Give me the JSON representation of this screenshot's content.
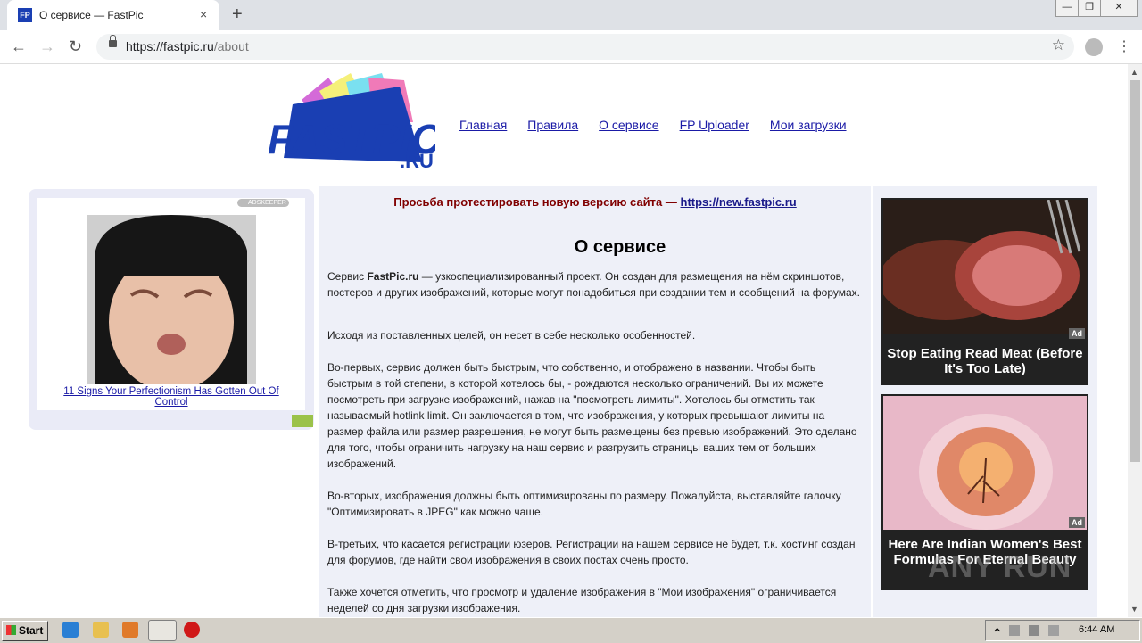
{
  "browser": {
    "tab_title": "О сервисе — FastPic",
    "favicon_text": "FP",
    "tab_close": "×",
    "new_tab": "+",
    "url_host": "https://fastpic.ru",
    "url_path": "/about",
    "window_controls": [
      "—",
      "❐",
      "✕"
    ]
  },
  "site": {
    "logo_text": "FASTPIC",
    "logo_domain": ".RU",
    "nav": [
      "Главная",
      "Правила",
      "О сервисе",
      "FP Uploader",
      "Мои загрузки"
    ]
  },
  "left_ad": {
    "badge": "ADSKEEPER",
    "caption": "11 Signs Your Perfectionism Has Gotten Out Of Control"
  },
  "main": {
    "notice_text": "Просьба протестировать новую версию сайта — ",
    "notice_link": "https://new.fastpic.ru",
    "heading": "О сервисе",
    "intro_prefix": "Сервис ",
    "intro_brand": "FastPic.ru",
    "intro_rest": " — узкоспециализированный проект. Он создан для размещения на нём скриншотов, постеров и других изображений, которые могут понадобиться при создании тем и сообщений на форумах.",
    "p2": "Исходя из поставленных целей, он несет в себе несколько особенностей.",
    "p3": "Во-первых, сервис должен быть быстрым, что собственно, и отображено в названии. Чтобы быть быстрым в той степени, в которой хотелось бы, - рождаются несколько ограничений. Вы их можете посмотреть при загрузке изображений, нажав на \"посмотреть лимиты\". Хотелось бы отметить так называемый hotlink limit. Он заключается в том, что изображения, у которых превышают лимиты на размер файла или размер разрешения, не могут быть размещены без превью изображений. Это сделано для того, чтобы ограничить нагрузку на наш сервис и разгрузить страницы ваших тем от больших изображений.",
    "p4": "Во-вторых, изображения должны быть оптимизированы по размеру. Пожалуйста, выставляйте галочку \"Оптимизировать в JPEG\" как можно чаще.",
    "p5": "В-третьих, что касается регистрации юзеров. Регистрации на нашем сервисе не будет, т.к. хостинг создан для форумов, где найти свои изображения в своих постах очень просто.",
    "p6": "Также хочется отметить, что просмотр и удаление изображения в \"Мои изображения\" ограничивается неделей со дня загрузки изображения."
  },
  "right_ads": [
    {
      "label": "Ad",
      "caption": "Stop Eating Read Meat (Before It's Too Late)"
    },
    {
      "label": "Ad",
      "caption": "Here Are Indian Women's Best Formulas For Eternal Beauty"
    }
  ],
  "watermark": "ANY RUN",
  "taskbar": {
    "start_label": "Start",
    "clock": "6:44 AM"
  }
}
